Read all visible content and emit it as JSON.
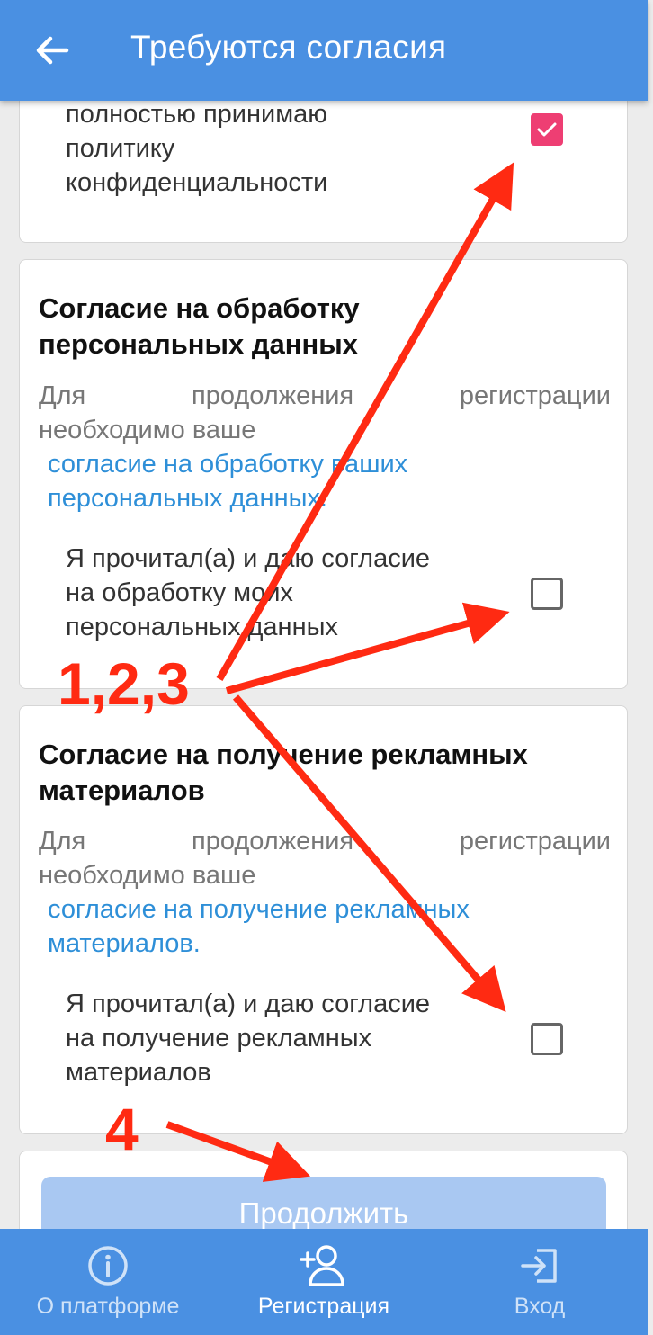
{
  "header": {
    "back_icon": "arrow-left-icon",
    "title": "Требуются согласия"
  },
  "privacy_card": {
    "check_text": [
      "полностью принимаю",
      "политику",
      "конфиденциальности"
    ],
    "checked": true
  },
  "personal_data_card": {
    "title": [
      "Согласие на обработку",
      "персональных данных"
    ],
    "desc_line1_words": [
      "Для",
      "продолжения",
      "регистрации"
    ],
    "desc_line2": "необходимо ваше",
    "link": [
      "согласие на обработку ваших",
      "персональных данных."
    ],
    "check_text": [
      "Я прочитал(а) и даю согласие",
      "на обработку моих",
      "персональных данных"
    ],
    "checked": false
  },
  "ads_card": {
    "title": [
      "Согласие на получение рекламных",
      "материалов"
    ],
    "desc_line1_words": [
      "Для",
      "продолжения",
      "регистрации"
    ],
    "desc_line2": "необходимо ваше",
    "link": [
      "согласие на получение рекламных",
      "материалов."
    ],
    "check_text": [
      "Я прочитал(а) и даю согласие",
      "на получение рекламных",
      "материалов"
    ],
    "checked": false
  },
  "continue_button": {
    "label": "Продолжить",
    "enabled": false
  },
  "tabbar": {
    "items": [
      {
        "label": "О платформе",
        "icon": "info-circle-icon",
        "active": false
      },
      {
        "label": "Регистрация",
        "icon": "add-user-icon",
        "active": true
      },
      {
        "label": "Вход",
        "icon": "login-icon",
        "active": false
      }
    ]
  },
  "annotations": {
    "label_checkboxes": "1,2,3",
    "label_button": "4",
    "color": "#ff2a12"
  },
  "colors": {
    "primary": "#4a90e2",
    "checkbox_checked": "#ee3e73",
    "link": "#2e8fd8",
    "button_disabled": "#a9c8f2"
  }
}
